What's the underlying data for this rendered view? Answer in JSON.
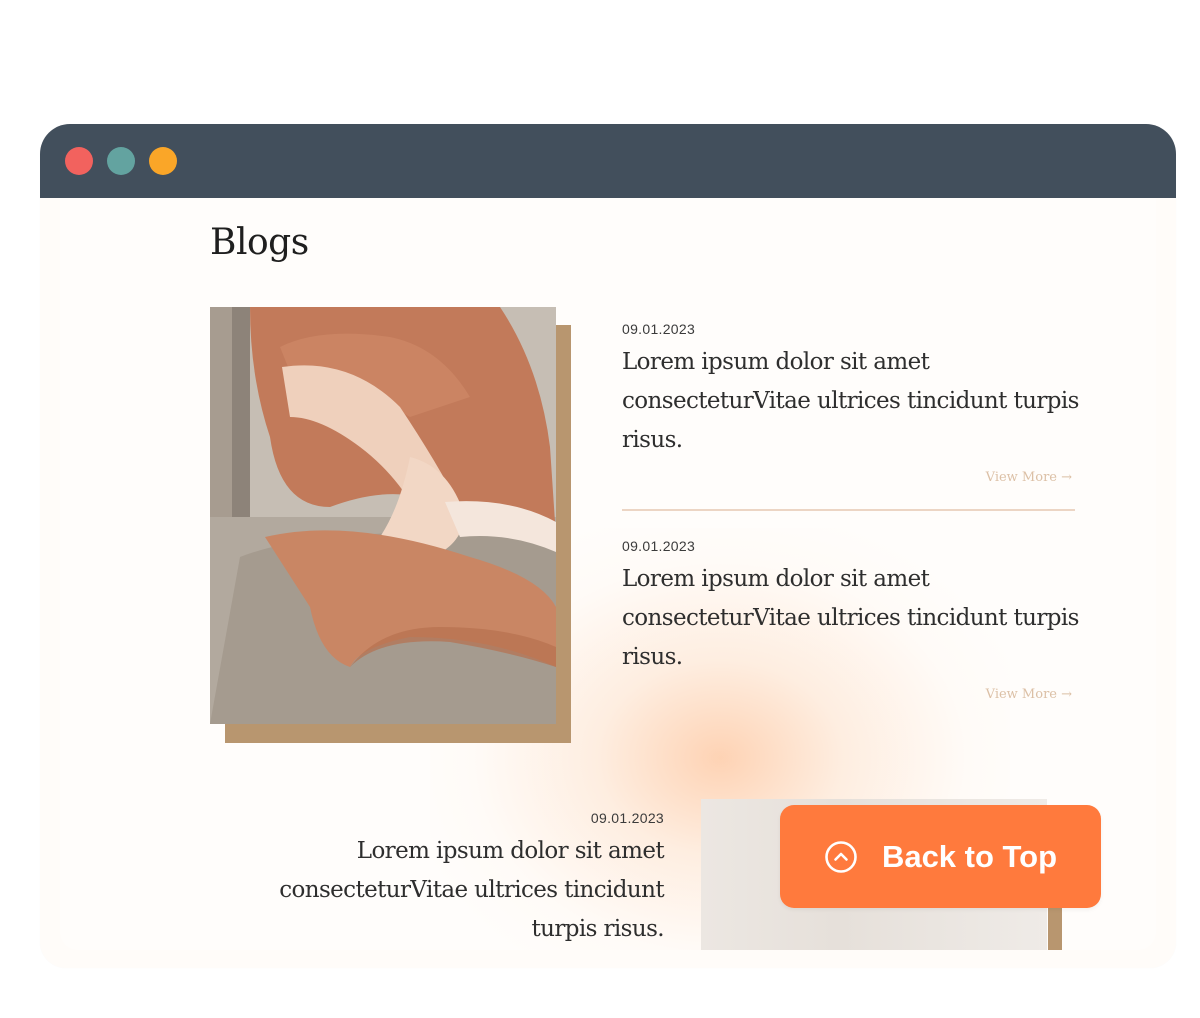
{
  "page": {
    "heading": "Blogs"
  },
  "posts": [
    {
      "date": "09.01.2023",
      "title": "Lorem ipsum dolor sit amet consecteturVitae ultrices tincidunt turpis risus.",
      "more": "View More →"
    },
    {
      "date": "09.01.2023",
      "title": "Lorem ipsum dolor sit amet consecteturVitae ultrices tincidunt turpis risus.",
      "more": "View More →"
    },
    {
      "date": "09.01.2023",
      "title": "Lorem ipsum dolor sit amet consecteturVitae ultrices tincidunt turpis risus."
    }
  ],
  "back_to_top": {
    "label": "Back to Top",
    "icon": "chevron-up-circle-icon"
  },
  "colors": {
    "titlebar": "#424f5c",
    "dot_red": "#f2625e",
    "dot_teal": "#63a3a0",
    "dot_yellow": "#faa628",
    "accent": "#ff7a3d",
    "photo_shadow": "#b8966f"
  }
}
